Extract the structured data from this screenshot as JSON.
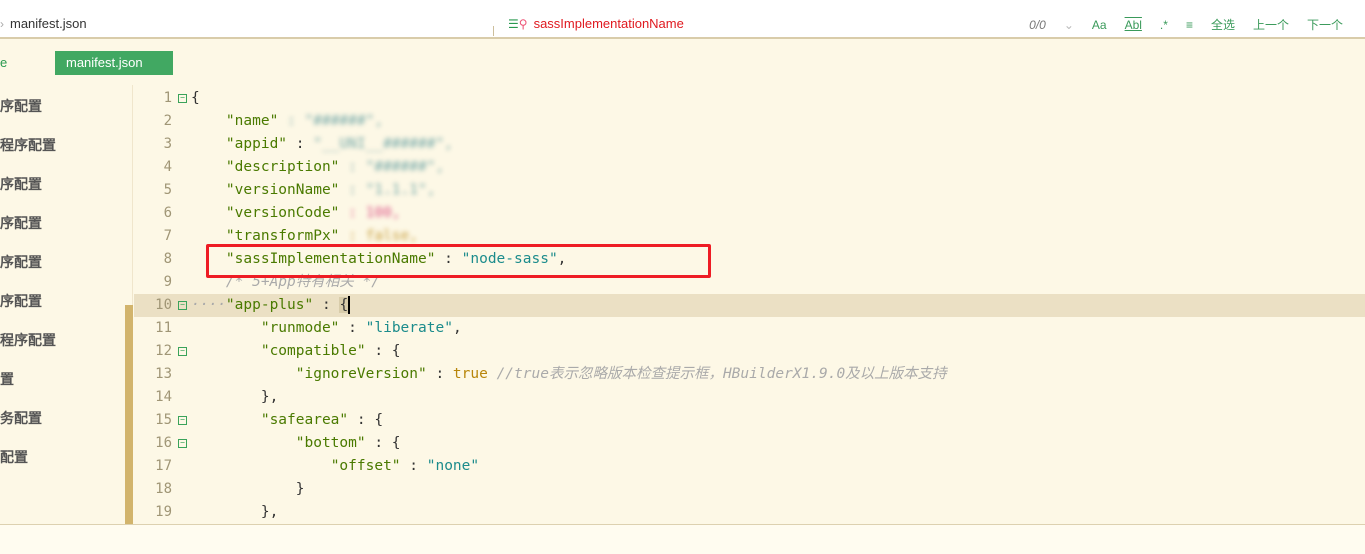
{
  "findbar": {
    "breadcrumb": "manifest.json",
    "search_value": "sassImplementationName",
    "match_count": "0/0",
    "select_all": "全选",
    "prev": "上一个",
    "next": "下一个"
  },
  "tabs": {
    "left_partial": "e",
    "active": "manifest.json"
  },
  "sidebar": {
    "items": [
      "序配置",
      "程序配置",
      "序配置",
      "序配置",
      "序配置",
      "序配置",
      "程序配置",
      "置",
      "务配置",
      "配置"
    ]
  },
  "editor": {
    "lines": [
      [
        [
          "p",
          "{"
        ]
      ],
      [
        [
          "p",
          "    "
        ],
        [
          "k",
          "\"name\""
        ],
        [
          "blur",
          " : \"######\","
        ]
      ],
      [
        [
          "p",
          "    "
        ],
        [
          "k",
          "\"appid\""
        ],
        [
          "p",
          " : "
        ],
        [
          "blur",
          "\"__UNI__######\","
        ]
      ],
      [
        [
          "p",
          "    "
        ],
        [
          "k",
          "\"description\""
        ],
        [
          "blur",
          " : \"######\","
        ]
      ],
      [
        [
          "p",
          "    "
        ],
        [
          "k",
          "\"versionName\""
        ],
        [
          "blur",
          " : \"1.1.1\","
        ]
      ],
      [
        [
          "p",
          "    "
        ],
        [
          "k",
          "\"versionCode\""
        ],
        [
          "blurpk",
          " : 100,"
        ]
      ],
      [
        [
          "p",
          "    "
        ],
        [
          "k",
          "\"transformPx\""
        ],
        [
          "p",
          " "
        ],
        [
          "bluryl",
          ": false,"
        ]
      ],
      [
        [
          "p",
          "    "
        ],
        [
          "k",
          "\"sassImplementationName\""
        ],
        [
          "p",
          " : "
        ],
        [
          "s",
          "\"node-sass\""
        ],
        [
          "p",
          ","
        ]
      ],
      [
        [
          "p",
          "    "
        ],
        [
          "c",
          "/* 5+App特有相关 */"
        ]
      ],
      [
        [
          "c",
          "····"
        ],
        [
          "k",
          "\"app-plus\""
        ],
        [
          "p",
          " : "
        ],
        [
          "cursor",
          "{"
        ]
      ],
      [
        [
          "p",
          "        "
        ],
        [
          "k",
          "\"runmode\""
        ],
        [
          "p",
          " : "
        ],
        [
          "s",
          "\"liberate\""
        ],
        [
          "p",
          ","
        ]
      ],
      [
        [
          "p",
          "        "
        ],
        [
          "k",
          "\"compatible\""
        ],
        [
          "p",
          " : {"
        ]
      ],
      [
        [
          "p",
          "            "
        ],
        [
          "k",
          "\"ignoreVersion\""
        ],
        [
          "p",
          " : "
        ],
        [
          "b",
          "true"
        ],
        [
          "p",
          " "
        ],
        [
          "c",
          "//true表示忽略版本检查提示框，HBuilderX1.9.0及以上版本支持"
        ]
      ],
      [
        [
          "p",
          "        },"
        ]
      ],
      [
        [
          "p",
          "        "
        ],
        [
          "k",
          "\"safearea\""
        ],
        [
          "p",
          " : {"
        ]
      ],
      [
        [
          "p",
          "            "
        ],
        [
          "k",
          "\"bottom\""
        ],
        [
          "p",
          " : {"
        ]
      ],
      [
        [
          "p",
          "                "
        ],
        [
          "k",
          "\"offset\""
        ],
        [
          "p",
          " : "
        ],
        [
          "s",
          "\"none\""
        ]
      ],
      [
        [
          "p",
          "            }"
        ]
      ],
      [
        [
          "p",
          "        },"
        ]
      ]
    ],
    "foldable": [
      1,
      10,
      12,
      15,
      16
    ],
    "current_line": 10
  }
}
